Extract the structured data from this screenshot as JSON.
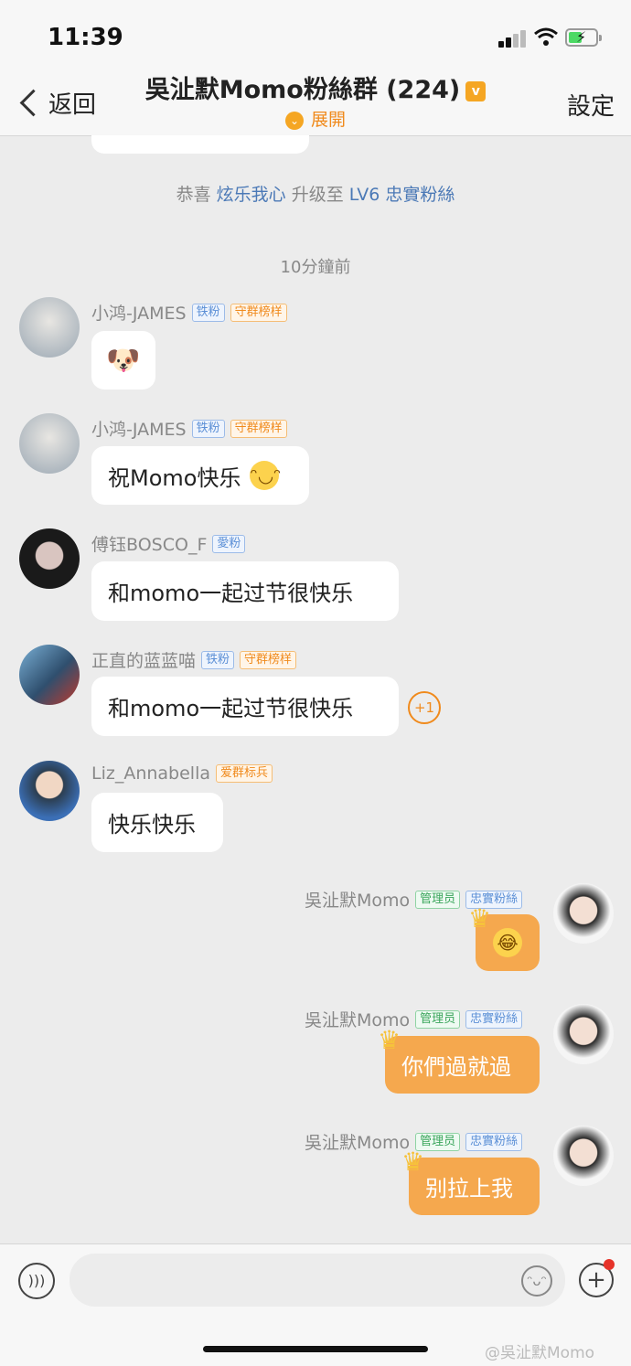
{
  "status_bar": {
    "time": "11:39"
  },
  "header": {
    "back_label": "返回",
    "title": "吳沚默Momo粉絲群 (224)",
    "expand_label": "展開",
    "settings_label": "設定"
  },
  "system_message": {
    "prefix": "恭喜",
    "user": "炫乐我心",
    "middle": "升级至",
    "level": "LV6 忠實粉絲"
  },
  "timestamp": "10分鐘前",
  "messages": [
    {
      "sender": "小鸿-JAMES",
      "badges": [
        "铁粉",
        "守群榜样"
      ],
      "content": "🐶"
    },
    {
      "sender": "小鸿-JAMES",
      "badges": [
        "铁粉",
        "守群榜样"
      ],
      "content": "祝Momo快乐"
    },
    {
      "sender": "傅钰BOSCO_F",
      "badges": [
        "愛粉"
      ],
      "content": "和momo一起过节很快乐"
    },
    {
      "sender": "正直的蓝蓝喵",
      "badges": [
        "铁粉",
        "守群榜样"
      ],
      "content": "和momo一起过节很快乐",
      "plus": "+1"
    },
    {
      "sender": "Liz_Annabella",
      "badges": [
        "爱群标兵"
      ],
      "content": "快乐快乐"
    },
    {
      "sender": "吳沚默Momo",
      "badges": [
        "管理员",
        "忠實粉絲"
      ],
      "content": "😂"
    },
    {
      "sender": "吳沚默Momo",
      "badges": [
        "管理员",
        "忠實粉絲"
      ],
      "content": "你們過就過"
    },
    {
      "sender": "吳沚默Momo",
      "badges": [
        "管理员",
        "忠實粉絲"
      ],
      "content": "别拉上我"
    }
  ],
  "watermark": "@吳沚默Momo",
  "colors": {
    "accent": "#f5a84e",
    "link": "#4b79b6",
    "background": "#ececec"
  }
}
